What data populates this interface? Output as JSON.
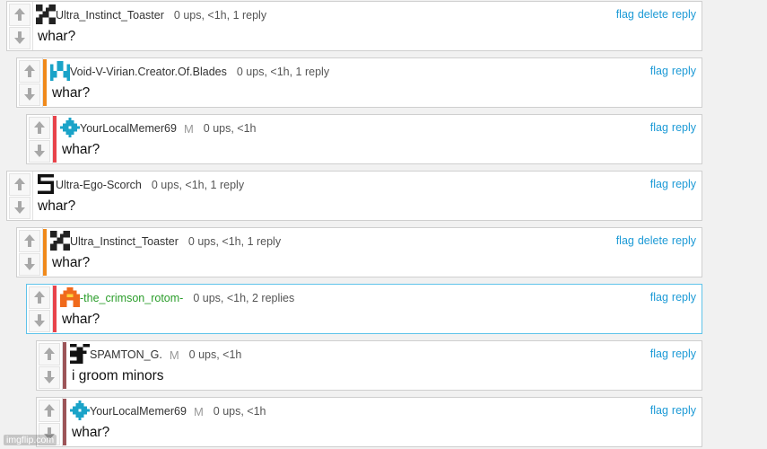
{
  "watermark": "imgflip.com",
  "comments": [
    {
      "username": "Ultra_Instinct_Toaster",
      "mod_label": "",
      "stats": "0 ups, <1h, 1 reply",
      "body": "whar?",
      "actions": [
        "flag",
        "delete",
        "reply"
      ],
      "avatar": "toaster-avatar-icon",
      "bar_color": "",
      "name_color": "#333333"
    },
    {
      "username": "Void-V-Virian.Creator.Of.Blades",
      "mod_label": "",
      "stats": "0 ups, <1h, 1 reply",
      "body": "whar?",
      "actions": [
        "flag",
        "reply"
      ],
      "avatar": "void-avatar-icon",
      "bar_color": "#f08a1c",
      "name_color": "#333333"
    },
    {
      "username": "YourLocalMemer69",
      "mod_label": "M",
      "stats": "0 ups, <1h",
      "body": "whar?",
      "actions": [
        "flag",
        "reply"
      ],
      "avatar": "memer-avatar-icon",
      "bar_color": "#e8434b",
      "name_color": "#333333"
    },
    {
      "username": "Ultra-Ego-Scorch",
      "mod_label": "",
      "stats": "0 ups, <1h, 1 reply",
      "body": "whar?",
      "actions": [
        "flag",
        "reply"
      ],
      "avatar": "scorch-avatar-icon",
      "bar_color": "",
      "name_color": "#333333"
    },
    {
      "username": "Ultra_Instinct_Toaster",
      "mod_label": "",
      "stats": "0 ups, <1h, 1 reply",
      "body": "whar?",
      "actions": [
        "flag",
        "delete",
        "reply"
      ],
      "avatar": "toaster-avatar-icon",
      "bar_color": "#f08a1c",
      "name_color": "#333333"
    },
    {
      "username": "-the_crimson_rotom-",
      "mod_label": "",
      "stats": "0 ups, <1h, 2 replies",
      "body": "whar?",
      "actions": [
        "flag",
        "reply"
      ],
      "avatar": "rotom-avatar-icon",
      "bar_color": "#e8434b",
      "name_color": "#2a9d2a"
    },
    {
      "username": "SPAMTON_G.",
      "mod_label": "M",
      "stats": "0 ups, <1h",
      "body": "i groom minors",
      "actions": [
        "flag",
        "reply"
      ],
      "avatar": "spamton-avatar-icon",
      "bar_color": "#9c5458",
      "name_color": "#333333"
    },
    {
      "username": "YourLocalMemer69",
      "mod_label": "M",
      "stats": "0 ups, <1h",
      "body": "whar?",
      "actions": [
        "flag",
        "reply"
      ],
      "avatar": "memer-avatar-icon",
      "bar_color": "#9c5458",
      "name_color": "#333333"
    }
  ]
}
